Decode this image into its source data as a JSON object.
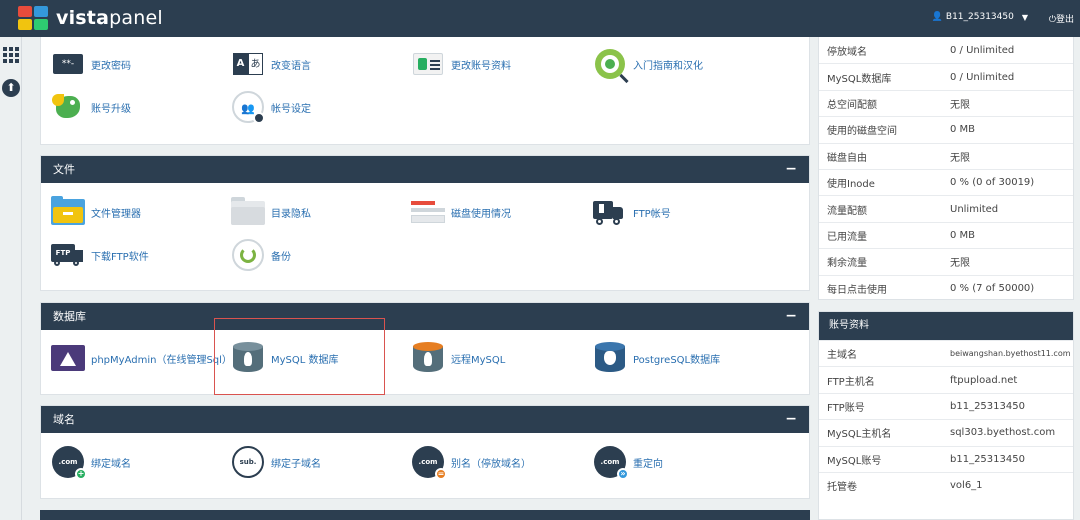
{
  "header": {
    "logo_prefix": "vista",
    "logo_suffix": "panel",
    "user": "B11_25313450",
    "logout": "登出",
    "colors": {
      "bar": "#2c3e50",
      "accent": "#2a6fb0"
    }
  },
  "account_section": {
    "items": [
      {
        "label": "更改密码",
        "icon": "key-icon"
      },
      {
        "label": "改变语言",
        "icon": "language-icon"
      },
      {
        "label": "更改账号资料",
        "icon": "contact-card-icon"
      },
      {
        "label": "入门指南和汉化",
        "icon": "search-guide-icon"
      },
      {
        "label": "账号升级",
        "icon": "dragon-icon"
      },
      {
        "label": "帐号设定",
        "icon": "account-settings-icon"
      }
    ]
  },
  "files_section": {
    "title": "文件",
    "collapse": "−",
    "items": [
      {
        "label": "文件管理器",
        "icon": "folder-icon"
      },
      {
        "label": "目录隐私",
        "icon": "private-folder-icon"
      },
      {
        "label": "磁盘使用情况",
        "icon": "disk-usage-icon"
      },
      {
        "label": "FTP帐号",
        "icon": "ftp-account-icon"
      },
      {
        "label": "下载FTP软件",
        "icon": "ftp-download-icon"
      },
      {
        "label": "备份",
        "icon": "backup-icon"
      }
    ]
  },
  "database_section": {
    "title": "数据库",
    "collapse": "−",
    "items": [
      {
        "label": "phpMyAdmin（在线管理Sql）",
        "icon": "phpmyadmin-icon"
      },
      {
        "label": "MySQL 数据库",
        "icon": "mysql-database-icon"
      },
      {
        "label": "远程MySQL",
        "icon": "remote-mysql-icon"
      },
      {
        "label": "PostgreSQL数据库",
        "icon": "postgresql-icon"
      }
    ]
  },
  "domain_section": {
    "title": "域名",
    "collapse": "−",
    "items": [
      {
        "label": "绑定域名",
        "icon": "addon-domain-icon",
        "badge": "+"
      },
      {
        "label": "绑定子域名",
        "icon": "subdomain-icon"
      },
      {
        "label": "别名（停放域名）",
        "icon": "parked-domain-icon",
        "badge": "="
      },
      {
        "label": "重定向",
        "icon": "redirect-icon",
        "badge": "»"
      }
    ],
    "dotcom_text": ".com",
    "sub_text": "sub."
  },
  "stats": [
    {
      "key": "停放域名",
      "value": "0 / Unlimited"
    },
    {
      "key": "MySQL数据库",
      "value": "0 / Unlimited"
    },
    {
      "key": "总空间配额",
      "value": "无限"
    },
    {
      "key": "使用的磁盘空间",
      "value": "0 MB"
    },
    {
      "key": "磁盘自由",
      "value": "无限"
    },
    {
      "key": "使用Inode",
      "value": "0 % (0 of 30019)"
    },
    {
      "key": "流量配额",
      "value": "Unlimited"
    },
    {
      "key": "已用流量",
      "value": "0 MB"
    },
    {
      "key": "剩余流量",
      "value": "无限"
    },
    {
      "key": "每日点击使用",
      "value": "0 % (7 of 50000)"
    }
  ],
  "account_info": {
    "title": "账号资料",
    "rows": [
      {
        "key": "主域名",
        "value": "beiwangshan.byethost11.com"
      },
      {
        "key": "FTP主机名",
        "value": "ftpupload.net"
      },
      {
        "key": "FTP账号",
        "value": "b11_25313450"
      },
      {
        "key": "MySQL主机名",
        "value": "sql303.byethost.com"
      },
      {
        "key": "MySQL账号",
        "value": "b11_25313450"
      },
      {
        "key": "托管卷",
        "value": "vol6_1"
      }
    ]
  },
  "icon_text": {
    "key": "**-",
    "lang_a": "A",
    "lang_b": "あ",
    "ftp": "FTP",
    "upload": "⬆"
  }
}
